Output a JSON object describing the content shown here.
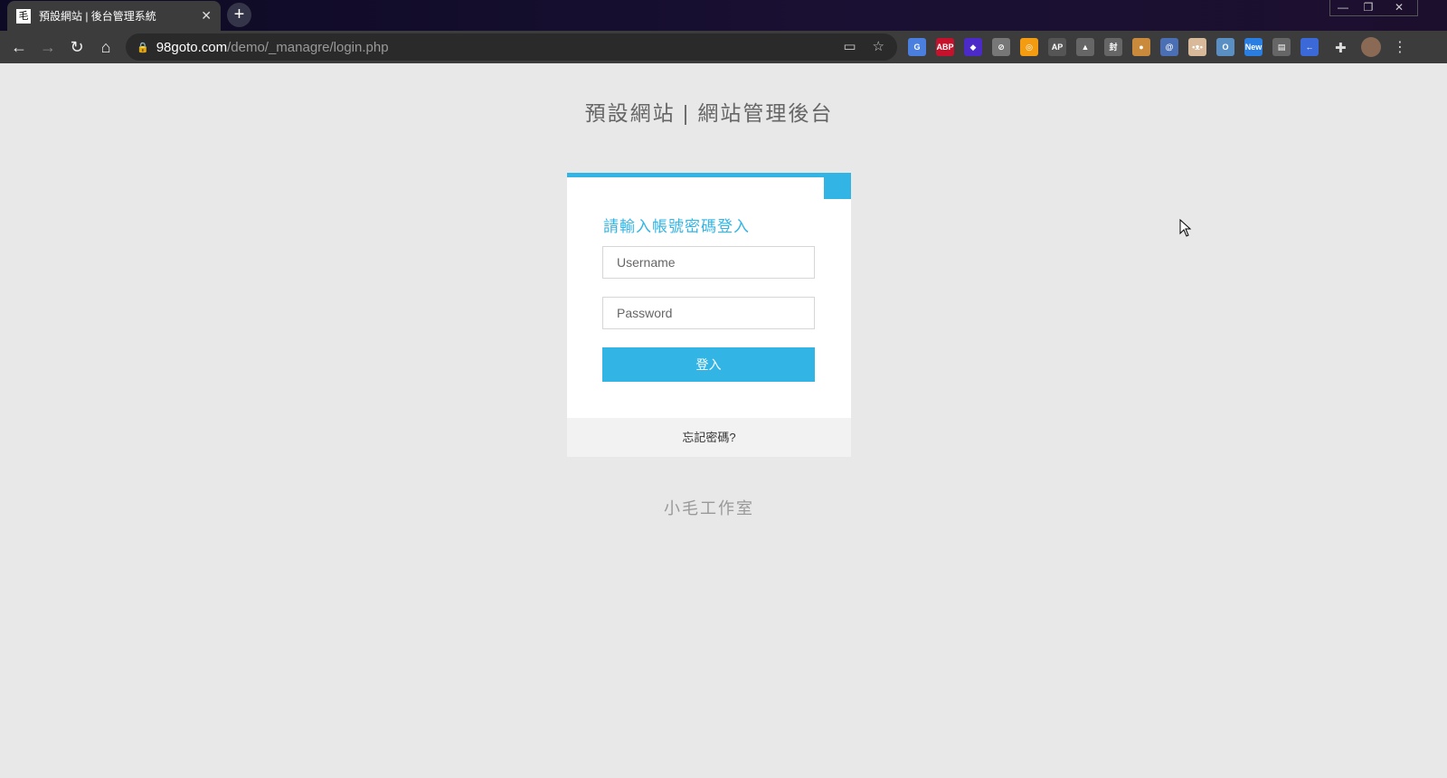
{
  "browser": {
    "tab_title": "預設網站 | 後台管理系統",
    "tab_favicon": "毛",
    "url_host": "98goto.com",
    "url_path": "/demo/_managre/login.php",
    "extensions": [
      {
        "name": "google-translate",
        "label": "G",
        "color": "#4a7fe0"
      },
      {
        "name": "adblock-plus",
        "label": "ABP",
        "color": "#c5112b"
      },
      {
        "name": "purple-ext",
        "label": "◆",
        "color": "#4b2ac8"
      },
      {
        "name": "grey-ext",
        "label": "⊘",
        "color": "#777"
      },
      {
        "name": "orange-ext",
        "label": "◎",
        "color": "#f39c12"
      },
      {
        "name": "ap-ext",
        "label": "AP",
        "color": "#555"
      },
      {
        "name": "drive-ext",
        "label": "▲",
        "color": "#666"
      },
      {
        "name": "feng-ext",
        "label": "封",
        "color": "#666"
      },
      {
        "name": "cookie-ext",
        "label": "●",
        "color": "#c98a3c"
      },
      {
        "name": "cursor-ext",
        "label": "@",
        "color": "#4a6fb5"
      },
      {
        "name": "box-ext",
        "label": "•ᴥ•",
        "color": "#d8b99a"
      },
      {
        "name": "ring-ext",
        "label": "O",
        "color": "#5a8fc4"
      },
      {
        "name": "new-ext",
        "label": "New",
        "color": "#2a7de1"
      },
      {
        "name": "chrome-ext",
        "label": "▤",
        "color": "#666"
      },
      {
        "name": "back-ext",
        "label": "←",
        "color": "#3b6ad8"
      }
    ]
  },
  "page": {
    "header_title": "預設網站 | 網站管理後台",
    "login_title": "請輸入帳號密碼登入",
    "username_placeholder": "Username",
    "password_placeholder": "Password",
    "login_button": "登入",
    "forgot_password": "忘記密碼?",
    "copyright": "小毛工作室"
  },
  "colors": {
    "accent": "#32b5e4",
    "background": "#e8e8e8"
  }
}
